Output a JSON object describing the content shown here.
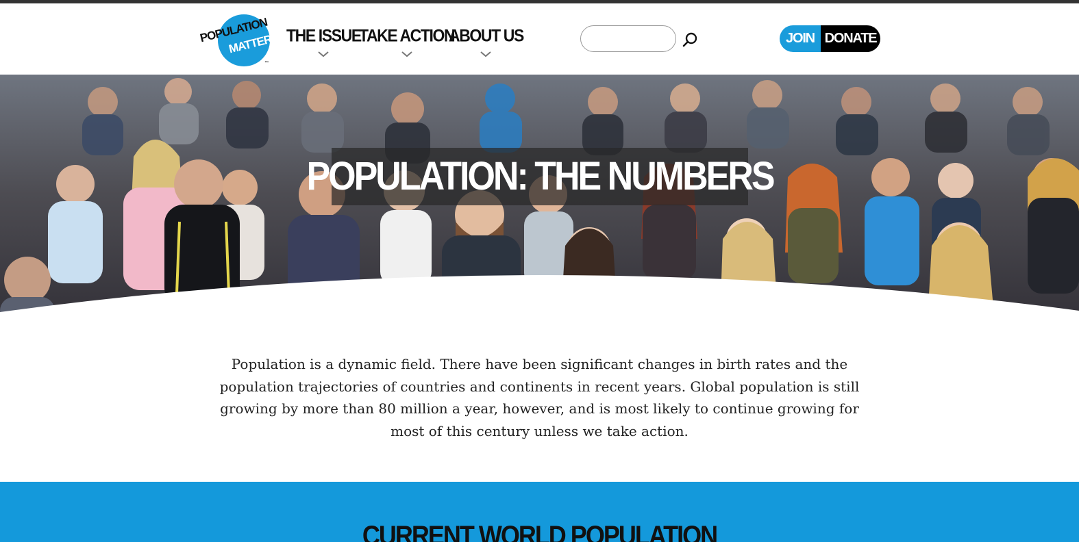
{
  "header": {
    "logo": {
      "line1": "POPULATION",
      "line2": "MATTERS",
      "mark": "™"
    },
    "nav": [
      {
        "label": "THE ISSUE",
        "icon": "chevron-down-icon"
      },
      {
        "label": "TAKE ACTION",
        "icon": "chevron-down-icon"
      },
      {
        "label": "ABOUT US",
        "icon": "chevron-down-icon"
      }
    ],
    "search": {
      "value": "",
      "placeholder": "",
      "icon": "search-icon"
    },
    "cta": {
      "join_label": "JOIN",
      "donate_label": "DONATE"
    }
  },
  "hero": {
    "title": "POPULATION: THE NUMBERS"
  },
  "intro": {
    "text": "Population is a dynamic field. There have been significant changes in birth rates and the population trajectories of countries and continents in recent years. Global population is still growing by more than 80 million a year, however, and is most likely to continue growing for most of this century unless we take action."
  },
  "counter": {
    "heading": "CURRENT WORLD POPULATION"
  },
  "colors": {
    "brand_blue": "#1a9cdb",
    "band_blue": "#1499db",
    "text_dark": "#111111",
    "top_bar": "#333333"
  }
}
